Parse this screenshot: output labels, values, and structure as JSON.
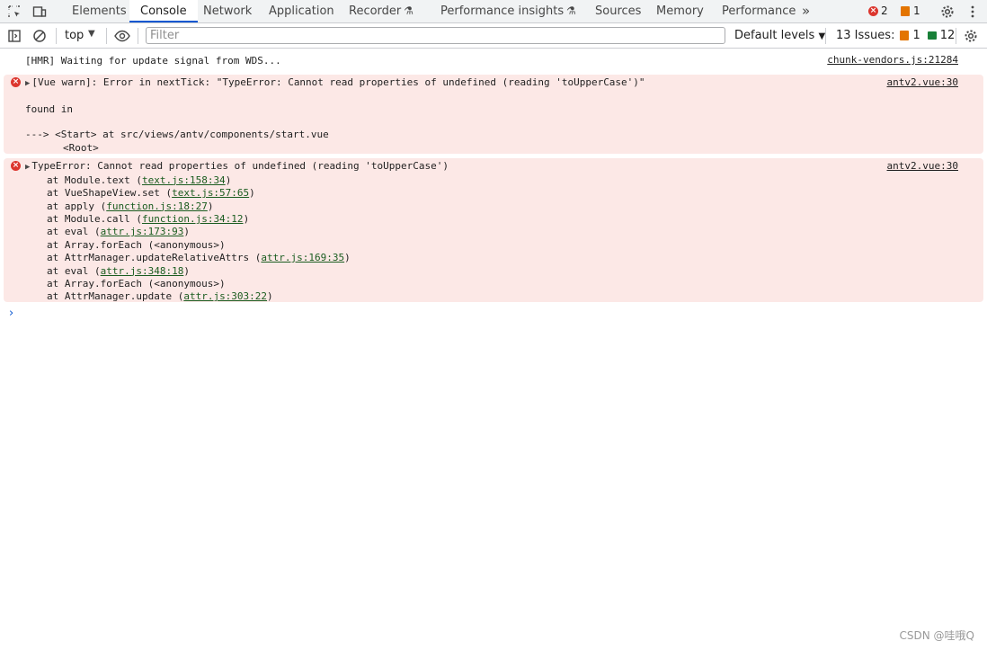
{
  "tabs": [
    "Elements",
    "Console",
    "Network",
    "Application",
    "Recorder",
    "Performance insights",
    "Sources",
    "Memory",
    "Performance"
  ],
  "active_tab": "Console",
  "more_tabs": "»",
  "error_count": "2",
  "warning_count": "1",
  "toolbar": {
    "context": "top",
    "filter_placeholder": "Filter",
    "levels": "Default levels",
    "issues_label": "13 Issues:",
    "issues_warn": "1",
    "issues_info": "12"
  },
  "messages": [
    {
      "text": "[HMR] Waiting for update signal from WDS...",
      "source": "chunk-vendors.js:21284"
    },
    {
      "text": "[Vue warn]: Error in nextTick: \"TypeError: Cannot read properties of undefined (reading 'toUpperCase')\"",
      "source": "antv2.vue:30",
      "found_in": "found in",
      "trace1": "---> <Start> at src/views/antv/components/start.vue",
      "trace2": "<Root>"
    },
    {
      "text": "TypeError: Cannot read properties of undefined (reading 'toUpperCase')",
      "source": "antv2.vue:30"
    }
  ],
  "stack": [
    {
      "fn": "at Module.text (",
      "link": "text.js:158:34",
      "end": ")"
    },
    {
      "fn": "at VueShapeView.set (",
      "link": "text.js:57:65",
      "end": ")"
    },
    {
      "fn": "at apply (",
      "link": "function.js:18:27",
      "end": ")"
    },
    {
      "fn": "at Module.call (",
      "link": "function.js:34:12",
      "end": ")"
    },
    {
      "fn": "at eval (",
      "link": "attr.js:173:93",
      "end": ")"
    },
    {
      "fn": "at Array.forEach (<anonymous>)",
      "link": "",
      "end": ""
    },
    {
      "fn": "at AttrManager.updateRelativeAttrs (",
      "link": "attr.js:169:35",
      "end": ")"
    },
    {
      "fn": "at eval (",
      "link": "attr.js:348:18",
      "end": ")"
    },
    {
      "fn": "at Array.forEach (<anonymous>)",
      "link": "",
      "end": ""
    },
    {
      "fn": "at AttrManager.update (",
      "link": "attr.js:303:22",
      "end": ")"
    }
  ],
  "prompt": "›",
  "watermark": "CSDN @哇哦Q"
}
